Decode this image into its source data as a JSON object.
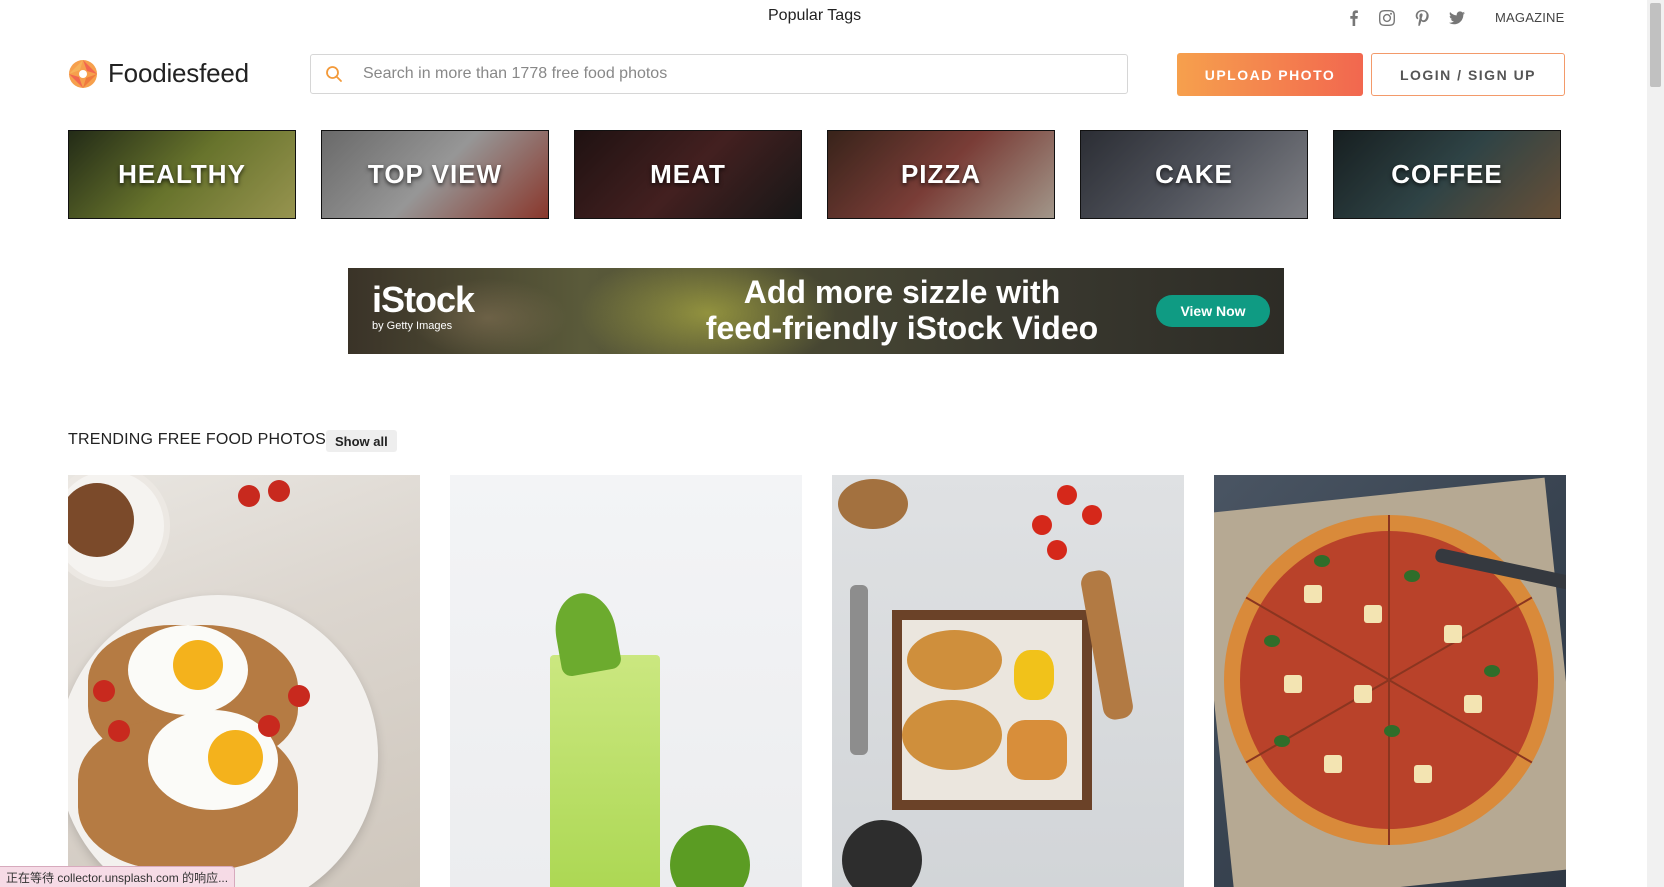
{
  "topbar": {
    "popular_tags": "Popular Tags",
    "social": [
      "facebook-icon",
      "instagram-icon",
      "pinterest-icon",
      "twitter-icon"
    ],
    "magazine": "MAGAZINE"
  },
  "header": {
    "logo_text": "Foodiesfeed",
    "search_placeholder": "Search in more than 1778 free food photos",
    "search_value": "",
    "upload_label": "UPLOAD PHOTO",
    "login_label": "LOGIN / SIGN UP",
    "accent_start": "#f6a04d",
    "accent_end": "#f2674f"
  },
  "categories": [
    {
      "label": "HEALTHY",
      "colors": [
        "#2f3a1f",
        "#8a9a3b",
        "#c9c56a"
      ]
    },
    {
      "label": "TOP VIEW",
      "colors": [
        "#8d8d8d",
        "#c9c9c9",
        "#b84a3b"
      ]
    },
    {
      "label": "MEAT",
      "colors": [
        "#2a1818",
        "#5a2b2b",
        "#1f1f1f"
      ]
    },
    {
      "label": "PIZZA",
      "colors": [
        "#4b2f23",
        "#a3524a",
        "#d8c9b8"
      ]
    },
    {
      "label": "CAKE",
      "colors": [
        "#3a3d46",
        "#6b6f7a",
        "#a9aab1"
      ]
    },
    {
      "label": "COFFEE",
      "colors": [
        "#1f2a2c",
        "#3f5a5d",
        "#8a6a4a"
      ]
    }
  ],
  "ad": {
    "brand": "iStock",
    "sub_brand": "by Getty Images",
    "headline_line1": "Add more sizzle with",
    "headline_line2": "feed-friendly iStock Video",
    "cta": "View Now"
  },
  "trending": {
    "title": "TRENDING FREE FOOD PHOTOS",
    "show_all": "Show all"
  },
  "status_bar": "正在等待 collector.unsplash.com 的响应..."
}
